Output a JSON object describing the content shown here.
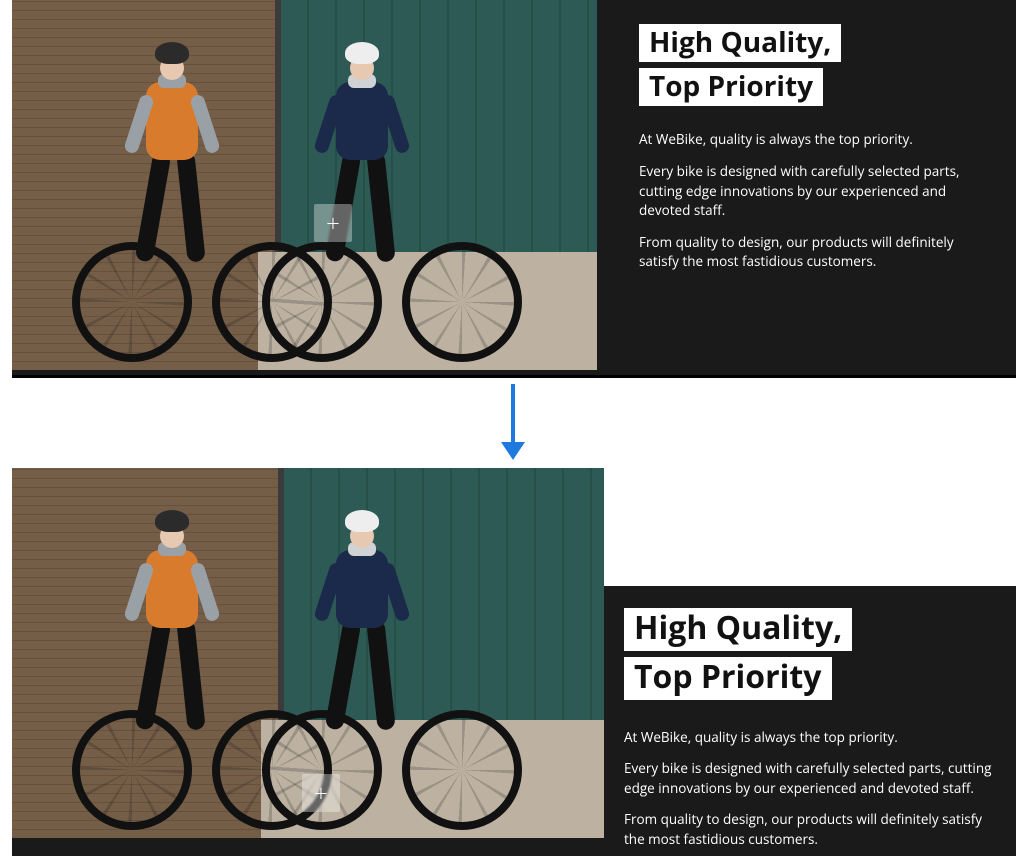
{
  "document_type": "before_after_comparison",
  "before": {
    "heading_line1": "High Quality,",
    "heading_line2": "Top Priority",
    "paragraphs": [
      "At WeBike, quality is always the top priority.",
      "Every bike is designed with carefully selected parts, cutting edge innovations by our experienced and devoted staff.",
      "From quality to design, our products will definitely satisfy the most fastidious customers."
    ],
    "image_overlay_icon": "plus-icon"
  },
  "after": {
    "heading_line1": "High Quality,",
    "heading_line2": "Top Priority",
    "paragraphs": [
      "At WeBike, quality is always the top priority.",
      "Every bike is designed with carefully selected parts, cutting edge innovations by our experienced and devoted staff.",
      "From quality to design, our products will definitely satisfy the most fastidious customers."
    ],
    "image_overlay_icon": "plus-icon"
  },
  "arrow": {
    "color": "#1f7ae0",
    "direction": "down"
  },
  "colors": {
    "panel_bg": "#1a1a1a",
    "text_on_dark": "#ffffff",
    "highlight_bg": "#ffffff",
    "highlight_text": "#111111"
  }
}
